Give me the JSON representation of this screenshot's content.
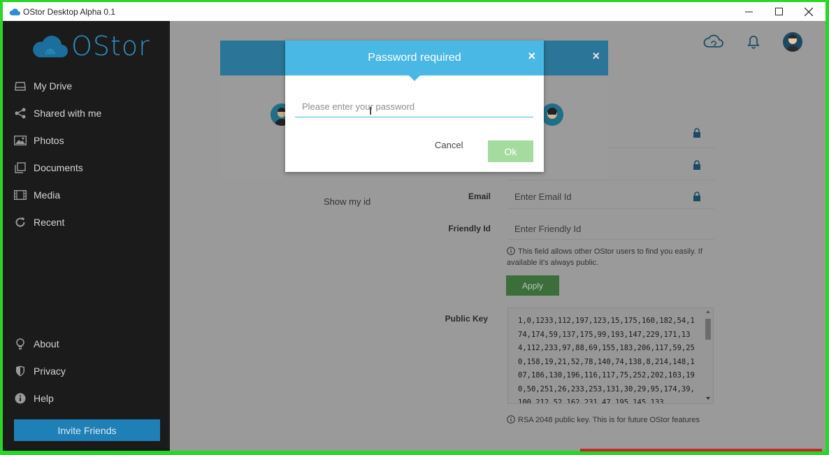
{
  "window": {
    "title": "OStor Desktop Alpha 0.1",
    "controls": [
      "minimize",
      "maximize",
      "close"
    ]
  },
  "sidebar": {
    "logo_text": "OStor",
    "items": [
      {
        "label": "My Drive",
        "icon": "drive-icon"
      },
      {
        "label": "Shared with me",
        "icon": "share-icon"
      },
      {
        "label": "Photos",
        "icon": "photo-icon"
      },
      {
        "label": "Documents",
        "icon": "documents-icon"
      },
      {
        "label": "Media",
        "icon": "film-icon"
      },
      {
        "label": "Recent",
        "icon": "refresh-icon"
      }
    ],
    "bottom_items": [
      {
        "label": "About",
        "icon": "bulb-icon"
      },
      {
        "label": "Privacy",
        "icon": "shield-icon"
      },
      {
        "label": "Help",
        "icon": "info-icon"
      }
    ],
    "invite_button": "Invite Friends"
  },
  "header": {
    "icons": [
      "cloud-sync-icon",
      "bell-icon",
      "avatar"
    ]
  },
  "profile": {
    "show_id": "Show my id",
    "email_label": "Email",
    "email_placeholder": "Enter Email Id",
    "friendly_label": "Friendly Id",
    "friendly_placeholder": "Enter Friendly Id",
    "friendly_info": "This field allows other OStor users to find you easily. If available it's always public.",
    "apply_button": "Apply",
    "public_key_label": "Public Key",
    "public_key_value": "1,0,1233,112,197,123,15,175,160,182,54,174,174,59,137,175,99,193,147,229,171,134,112,233,97,88,69,155,183,206,117,59,250,158,19,21,52,78,140,74,138,8,214,148,107,186,130,196,116,117,75,252,202,103,190,50,251,26,233,253,131,30,29,95,174,39,100,212,52,162,231,47,195,145,133",
    "public_key_info": "RSA 2048 public key. This is for future OStor features"
  },
  "dialog": {
    "title": "Password required",
    "close": "×",
    "placeholder": "Please enter your password",
    "value": "",
    "cancel": "Cancel",
    "ok": "Ok"
  },
  "background_dialog": {
    "close": "×"
  },
  "colors": {
    "accent": "#4ab8e5",
    "sidebar_bg": "#1b1b1b",
    "ok_button": "#a6dba0",
    "apply_button": "#3b6e3b",
    "invite_button": "#1f80b8"
  }
}
